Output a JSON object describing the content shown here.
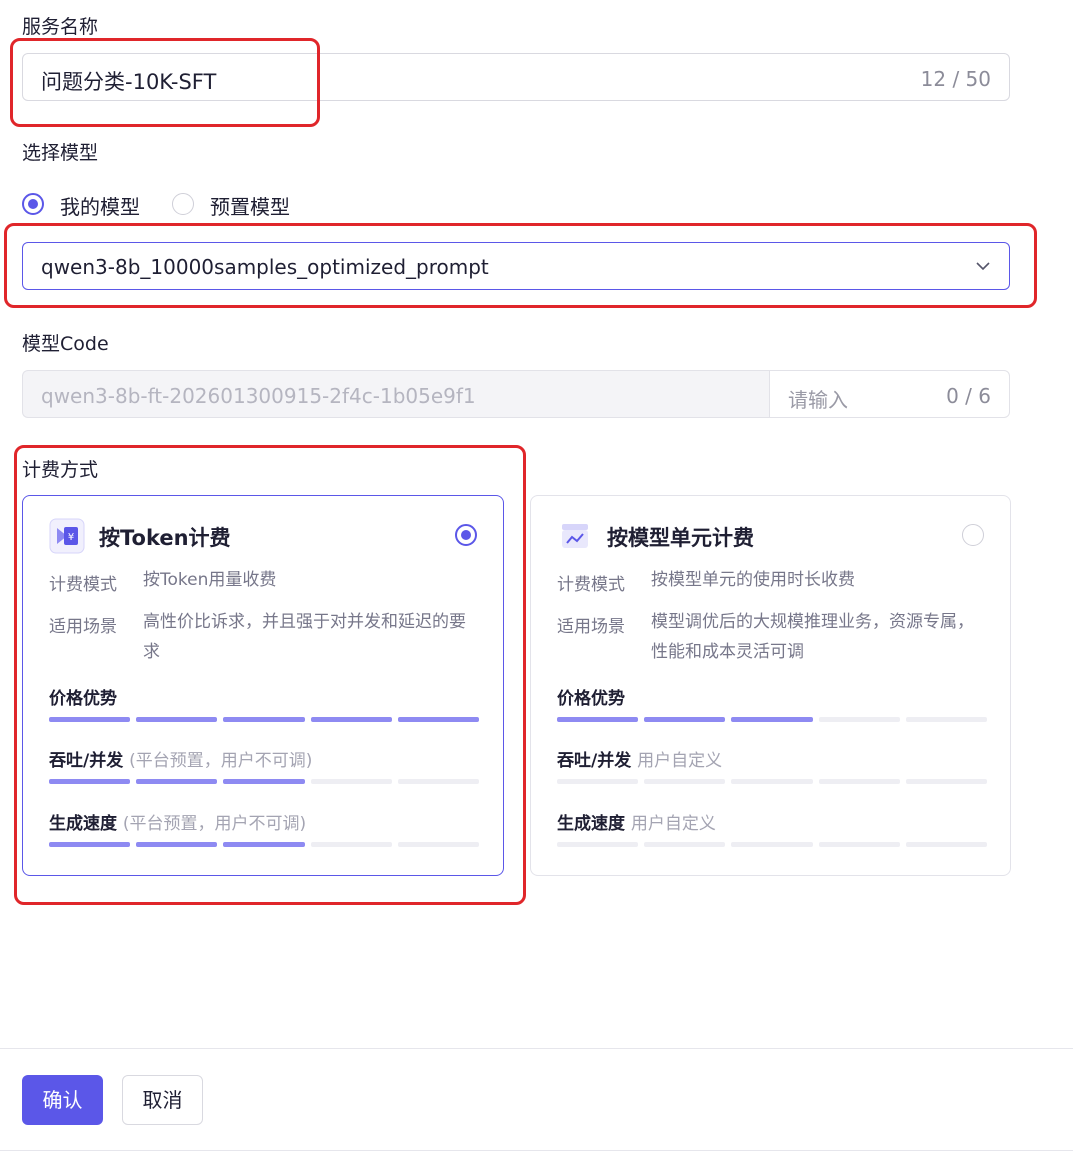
{
  "service_name": {
    "label": "服务名称",
    "value": "问题分类-10K-SFT",
    "counter": "12 / 50"
  },
  "model_select": {
    "label": "选择模型",
    "options": [
      {
        "label": "我的模型",
        "checked": true
      },
      {
        "label": "预置模型",
        "checked": false
      }
    ],
    "selected_value": "qwen3-8b_10000samples_optimized_prompt"
  },
  "model_code": {
    "label": "模型Code",
    "prefix_value": "qwen3-8b-ft-202601300915-2f4c-1b05e9f1",
    "placeholder": "请输入",
    "counter": "0 / 6"
  },
  "billing": {
    "label": "计费方式",
    "cards": [
      {
        "title": "按Token计费",
        "selected": true,
        "icon": "token-billing-icon",
        "mode_key": "计费模式",
        "mode_value": "按Token用量收费",
        "scene_key": "适用场景",
        "scene_value": "高性价比诉求，并且强于对并发和延迟的要求",
        "price_label": "价格优势",
        "price_level": 5,
        "throughput_label": "吞吐/并发",
        "throughput_note": "(平台预置，用户不可调)",
        "throughput_level": 3,
        "speed_label": "生成速度",
        "speed_note": "(平台预置，用户不可调)",
        "speed_level": 3
      },
      {
        "title": "按模型单元计费",
        "selected": false,
        "icon": "model-unit-billing-icon",
        "mode_key": "计费模式",
        "mode_value": "按模型单元的使用时长收费",
        "scene_key": "适用场景",
        "scene_value": "模型调优后的大规模推理业务，资源专属，性能和成本灵活可调",
        "price_label": "价格优势",
        "price_level": 3,
        "throughput_label": "吞吐/并发",
        "throughput_note": "用户自定义",
        "throughput_level": 0,
        "speed_label": "生成速度",
        "speed_note": "用户自定义",
        "speed_level": 0
      }
    ],
    "max_level": 5
  },
  "footer": {
    "confirm": "确认",
    "cancel": "取消"
  },
  "colors": {
    "accent": "#5b57e8",
    "bar_on": "#8e8af2",
    "bar_off": "#eeeef3",
    "annotation": "#e0262a"
  }
}
